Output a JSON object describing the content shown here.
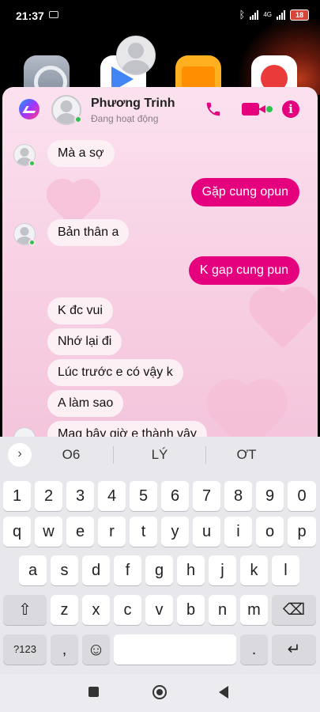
{
  "status": {
    "time": "21:37",
    "network": "4G",
    "battery": "18"
  },
  "contact": {
    "name": "Phương Trinh",
    "status": "Đang hoạt động"
  },
  "messages": [
    {
      "text": "Mà a sợ",
      "dir": "in"
    },
    {
      "text": "Gặp cung opun",
      "dir": "out"
    },
    {
      "text": "Bản thân a",
      "dir": "in"
    },
    {
      "text": "K gap cung pun",
      "dir": "out"
    },
    {
      "text": "K đc vui",
      "dir": "in"
    },
    {
      "text": "Nhớ lại đi",
      "dir": "in"
    },
    {
      "text": "Lúc trước e có vậy k",
      "dir": "in"
    },
    {
      "text": "A làm sao",
      "dir": "in"
    },
    {
      "text": "Mag bây giờ e thành vậy",
      "dir": "in"
    }
  ],
  "suggestions": [
    "O6",
    "LÝ",
    "ƠT"
  ],
  "keyboard": {
    "numbers": [
      "1",
      "2",
      "3",
      "4",
      "5",
      "6",
      "7",
      "8",
      "9",
      "0"
    ],
    "row1": [
      "q",
      "w",
      "e",
      "r",
      "t",
      "y",
      "u",
      "i",
      "o",
      "p"
    ],
    "row2": [
      "a",
      "s",
      "d",
      "f",
      "g",
      "h",
      "j",
      "k",
      "l"
    ],
    "row3": [
      "z",
      "x",
      "c",
      "v",
      "b",
      "n",
      "m"
    ],
    "symbols_key": "?123",
    "comma": ",",
    "period": ".",
    "shift_icon": "⇧",
    "backspace_icon": "⌫",
    "enter_icon": "↵",
    "emoji_icon": "☺",
    "suggest_arrow": "›"
  },
  "icons": {
    "info": "i"
  },
  "colors": {
    "accent": "#e5007e",
    "online": "#31c24d"
  }
}
